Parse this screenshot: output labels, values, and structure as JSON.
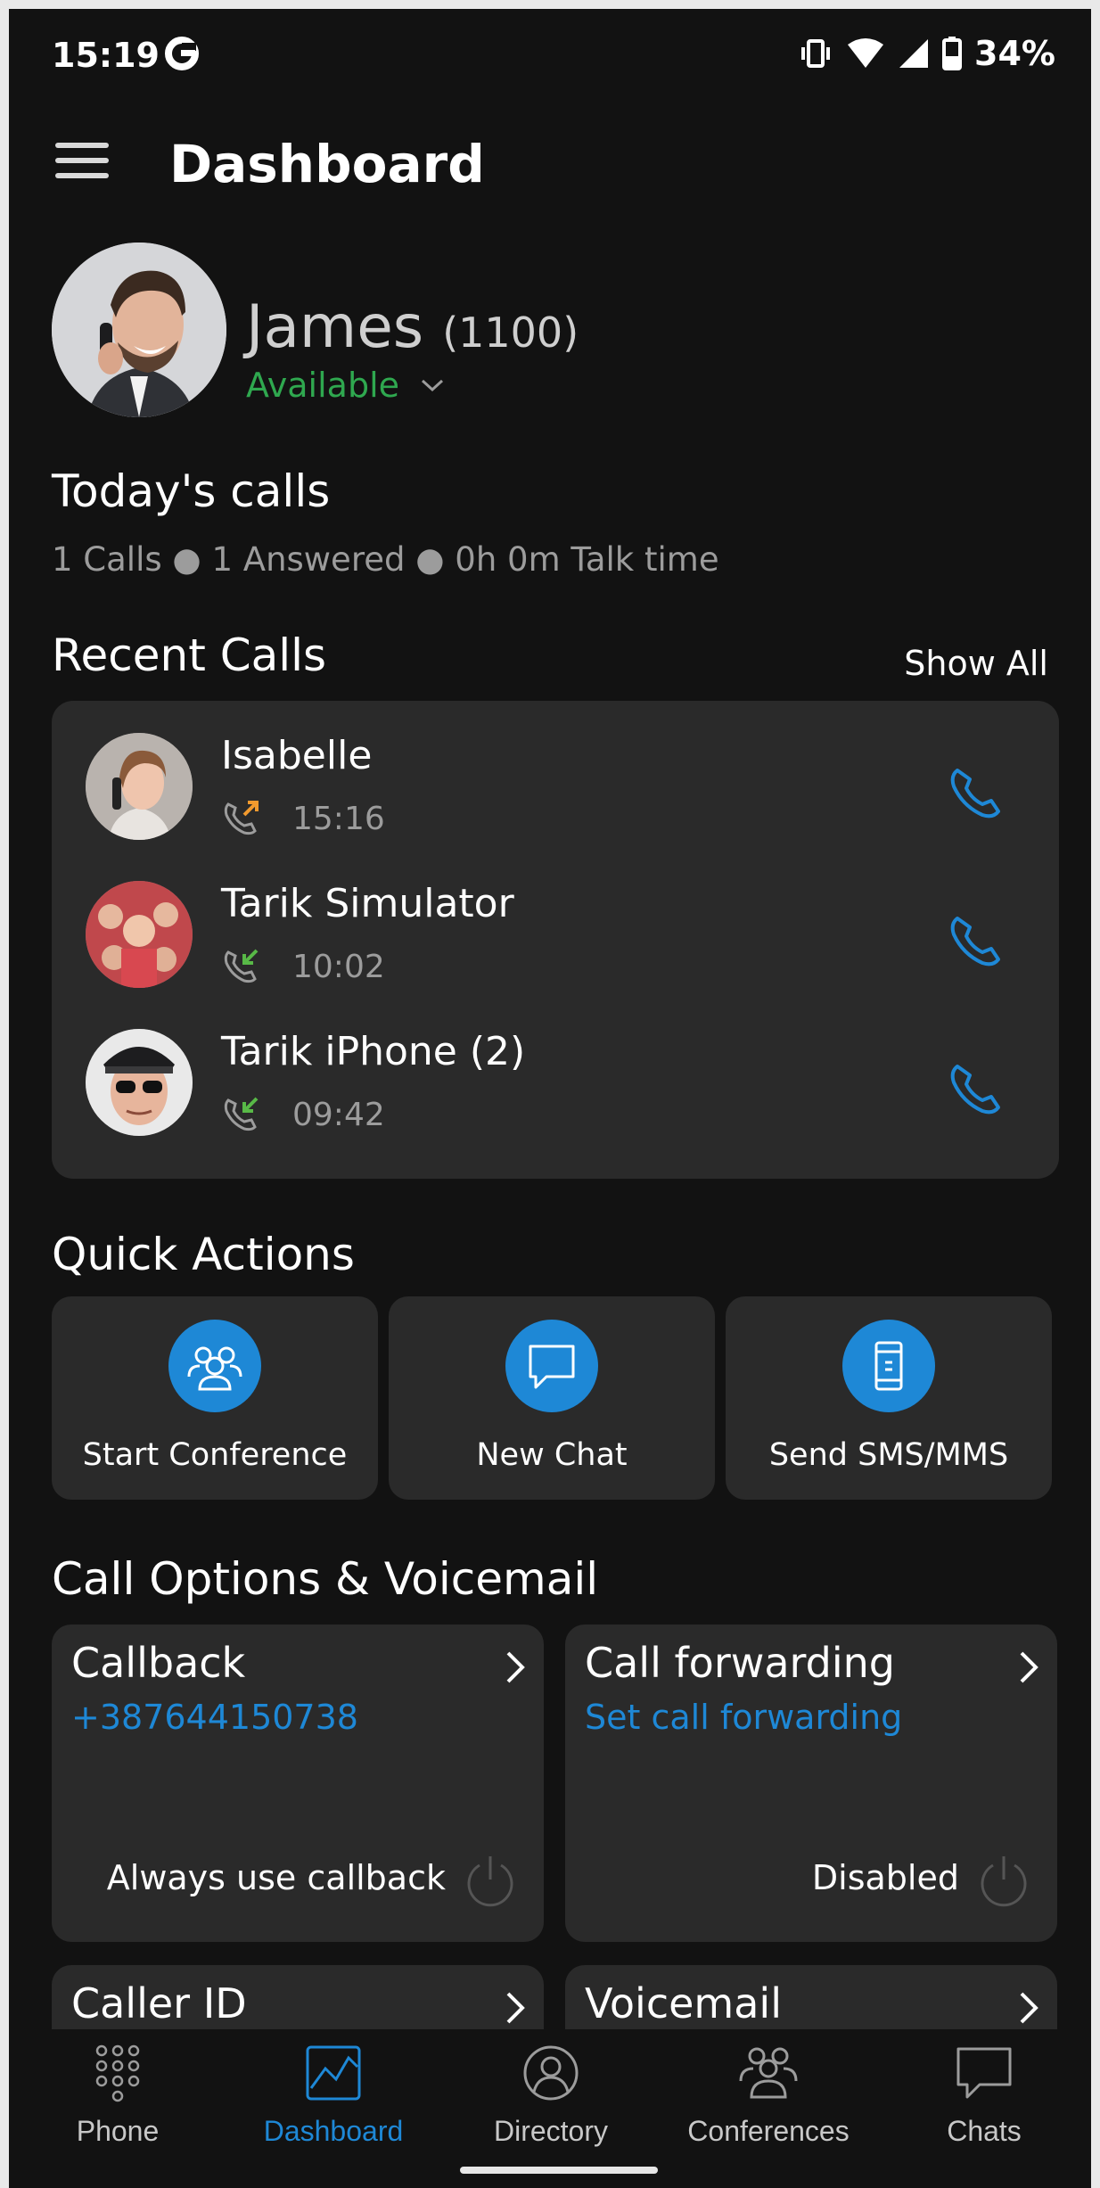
{
  "status_bar": {
    "time": "15:19",
    "battery": "34%"
  },
  "app_bar": {
    "title": "Dashboard"
  },
  "profile": {
    "name": "James",
    "extension": "(1100)",
    "status": "Available"
  },
  "todays_calls": {
    "title": "Today's calls",
    "summary": "1 Calls ● 1 Answered ● 0h 0m Talk time"
  },
  "recent_calls": {
    "title": "Recent Calls",
    "show_all": "Show All",
    "items": [
      {
        "name": "Isabelle",
        "time": "15:16",
        "direction": "outgoing"
      },
      {
        "name": "Tarik Simulator",
        "time": "10:02",
        "direction": "incoming"
      },
      {
        "name": "Tarik iPhone (2)",
        "time": "09:42",
        "direction": "incoming"
      }
    ]
  },
  "quick_actions": {
    "title": "Quick Actions",
    "items": [
      {
        "label": "Start Conference",
        "icon": "conference-icon"
      },
      {
        "label": "New Chat",
        "icon": "chat-icon"
      },
      {
        "label": "Send SMS/MMS",
        "icon": "mobile-phone-icon"
      }
    ]
  },
  "call_options": {
    "title": "Call Options & Voicemail",
    "callback": {
      "title": "Callback",
      "value": "+387644150738",
      "footer": "Always use callback"
    },
    "call_forwarding": {
      "title": "Call forwarding",
      "value": "Set call forwarding",
      "footer": "Disabled"
    },
    "caller_id": {
      "title": "Caller ID"
    },
    "voicemail": {
      "title": "Voicemail"
    }
  },
  "bottom_nav": {
    "items": [
      {
        "label": "Phone",
        "icon": "dialpad-icon"
      },
      {
        "label": "Dashboard",
        "icon": "dashboard-icon",
        "active": true
      },
      {
        "label": "Directory",
        "icon": "directory-icon"
      },
      {
        "label": "Conferences",
        "icon": "conferences-icon"
      },
      {
        "label": "Chats",
        "icon": "chats-icon"
      }
    ]
  },
  "colors": {
    "background": "#121212",
    "card": "#2a2a2a",
    "accent": "#1e88d6",
    "available": "#2fa84f",
    "outgoing": "#f29a2e",
    "incoming": "#58b947",
    "muted": "#9c9c9c"
  }
}
